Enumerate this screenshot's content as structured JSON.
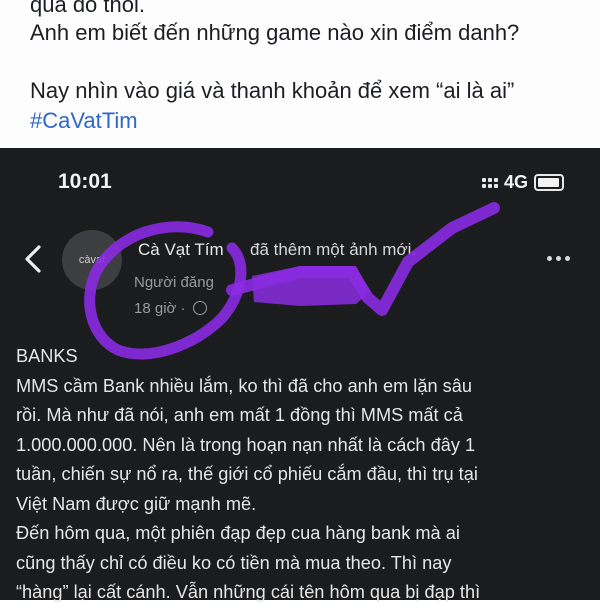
{
  "top_post": {
    "cut_line": "qua đó thôi.",
    "line1": "Anh em biết đến những game nào xin điểm danh?",
    "line2": "Nay nhìn vào giá và thanh khoản để xem “ai là ai”",
    "hashtag": "#CaVatTim"
  },
  "status_bar": {
    "time": "10:01",
    "network": "4G"
  },
  "post_header": {
    "avatar_text": "càvạt",
    "author": "Cà Vạt Tím",
    "action": "đã thêm một ảnh mới.",
    "subtitle": "Người đăng",
    "time": "18 giờ ·"
  },
  "post_body": {
    "lines": [
      "BANKS",
      "MMS cầm Bank nhiều lắm, ko thì đã cho anh em lặn sâu",
      "rồi. Mà như đã nói, anh em mất 1 đồng thì MMS mất cả",
      "1.000.000.000. Nên là trong hoạn nạn nhất là cách đây 1",
      "tuần, chiến sự nổ ra, thế giới cổ phiếu cắm đầu, thì trụ tại",
      "Việt Nam được giữ mạnh mẽ.",
      "Đến hôm qua, một phiên đạp đẹp cua hàng bank mà ai",
      "cũng thấy chỉ có điều ko có tiền mà mua theo. Thì nay",
      "“hàng” lại cất cánh. Vẫn những cái tên hôm qua bị đạp thì"
    ]
  },
  "colors": {
    "dark_background": "#1b1c1e",
    "hashtag": "#2f66c7",
    "scribble": "#8a2be2"
  }
}
